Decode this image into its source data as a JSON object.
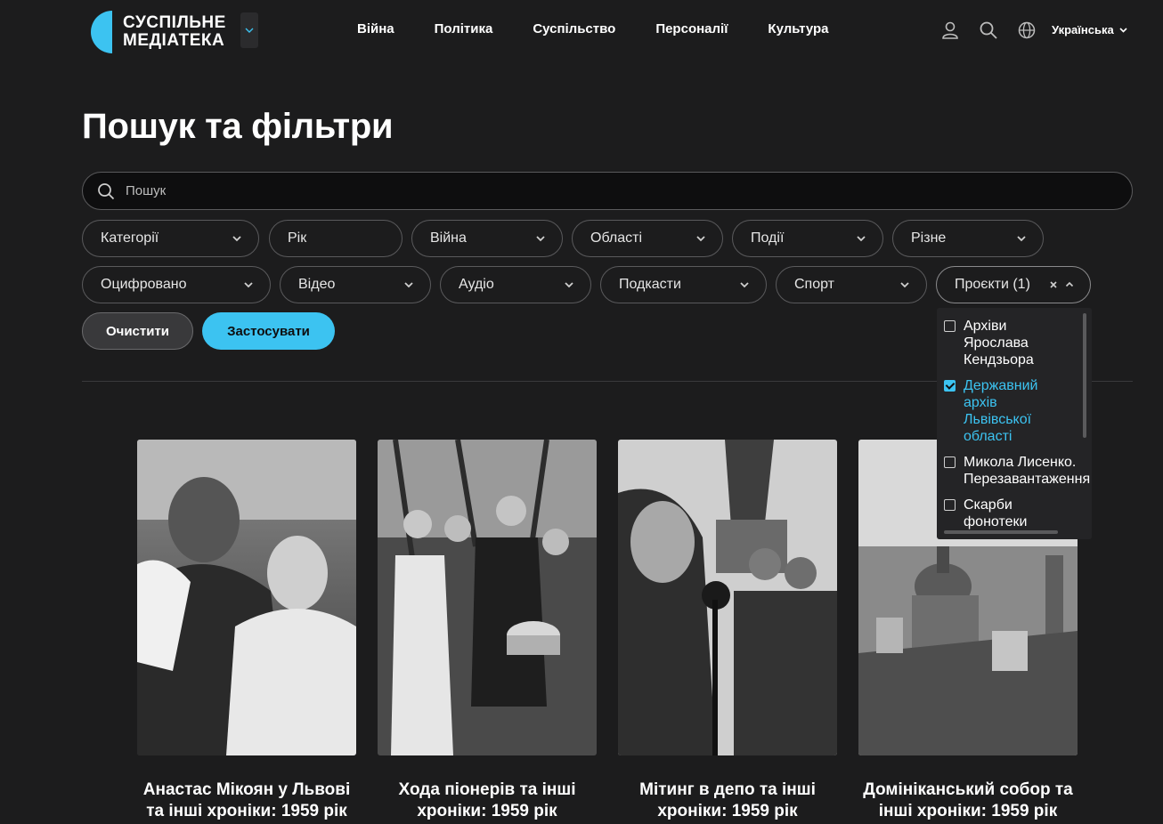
{
  "header": {
    "logo_line1": "СУСПІЛЬНЕ",
    "logo_line2": "МЕДІАТЕКА",
    "nav": [
      "Війна",
      "Політика",
      "Суспільство",
      "Персоналії",
      "Культура"
    ],
    "language": "Українська",
    "icons": [
      "user-icon",
      "search-icon",
      "globe-icon",
      "chevron-down-icon"
    ]
  },
  "page": {
    "title": "Пошук та фільтри"
  },
  "search": {
    "placeholder": "Пошук",
    "value": ""
  },
  "filters": {
    "row1": [
      {
        "label": "Категорії"
      },
      {
        "label": "Рік"
      },
      {
        "label": "Війна"
      },
      {
        "label": "Області"
      },
      {
        "label": "Події"
      },
      {
        "label": "Різне"
      }
    ],
    "row2": [
      {
        "label": "Оцифровано"
      },
      {
        "label": "Відео"
      },
      {
        "label": "Аудіо"
      },
      {
        "label": "Подкасти"
      },
      {
        "label": "Спорт"
      },
      {
        "label": "Проєкти (1)"
      }
    ]
  },
  "buttons": {
    "clear": "Очистити",
    "apply": "Застосувати"
  },
  "projects_dropdown": {
    "items": [
      {
        "lines": [
          "Архіви",
          "Ярослава",
          "Кендзьора"
        ],
        "checked": false
      },
      {
        "lines": [
          "Державний",
          "архів",
          "Львівської",
          "області"
        ],
        "checked": true
      },
      {
        "lines": [
          "Микола Лисенко.",
          "Перезавантаження"
        ],
        "checked": false
      },
      {
        "lines": [
          "Скарби",
          "фонотеки"
        ],
        "checked": false
      }
    ]
  },
  "cards": [
    {
      "title_l1": "Анастас Мікоян у Львові",
      "title_l2": "та інші хроніки: 1959 рік"
    },
    {
      "title_l1": "Хода піонерів та інші",
      "title_l2": "хроніки: 1959 рік"
    },
    {
      "title_l1": "Мітинг в депо та інші",
      "title_l2": "хроніки: 1959 рік"
    },
    {
      "title_l1": "Домініканський собор та",
      "title_l2": "інші хроніки: 1959 рік"
    }
  ],
  "colors": {
    "background": "#1c1c1d",
    "accent": "#3cc3f1",
    "border": "#5a5a5c"
  }
}
